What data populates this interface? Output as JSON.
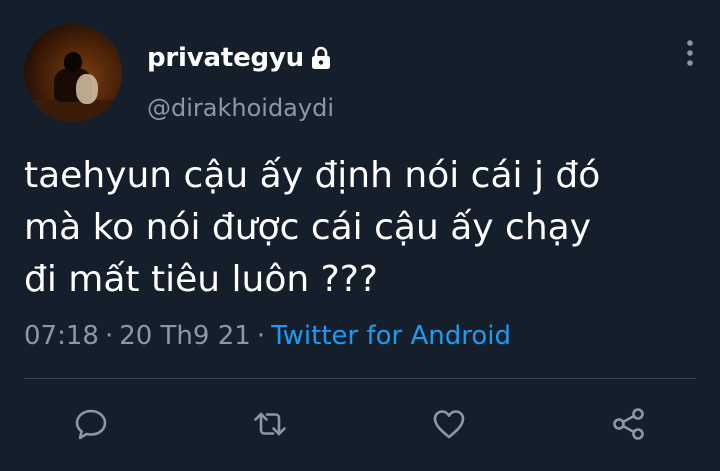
{
  "tweet": {
    "author": {
      "display_name": "privategyu",
      "username": "@dirakhoidaydi",
      "avatar_icon": "avatar-photo",
      "protected_icon": "lock-icon"
    },
    "text_lines": [
      "taehyun cậu ấy định nói cái j đó",
      "mà ko nói được cái cậu ấy chạy",
      "đi mất tiêu luôn ???"
    ],
    "time": "07:18",
    "date": "20 Th9 21",
    "separator": "·",
    "source": "Twitter for Android"
  },
  "actions": [
    {
      "icon": "reply-icon"
    },
    {
      "icon": "retweet-icon"
    },
    {
      "icon": "like-icon"
    },
    {
      "icon": "share-icon"
    }
  ],
  "menu_icon": "more-options-icon",
  "colors": {
    "background": "#151f2b",
    "text": "#ffffff",
    "secondary": "#8b98a5",
    "link": "#1d9bf0",
    "divider": "#38444d"
  }
}
